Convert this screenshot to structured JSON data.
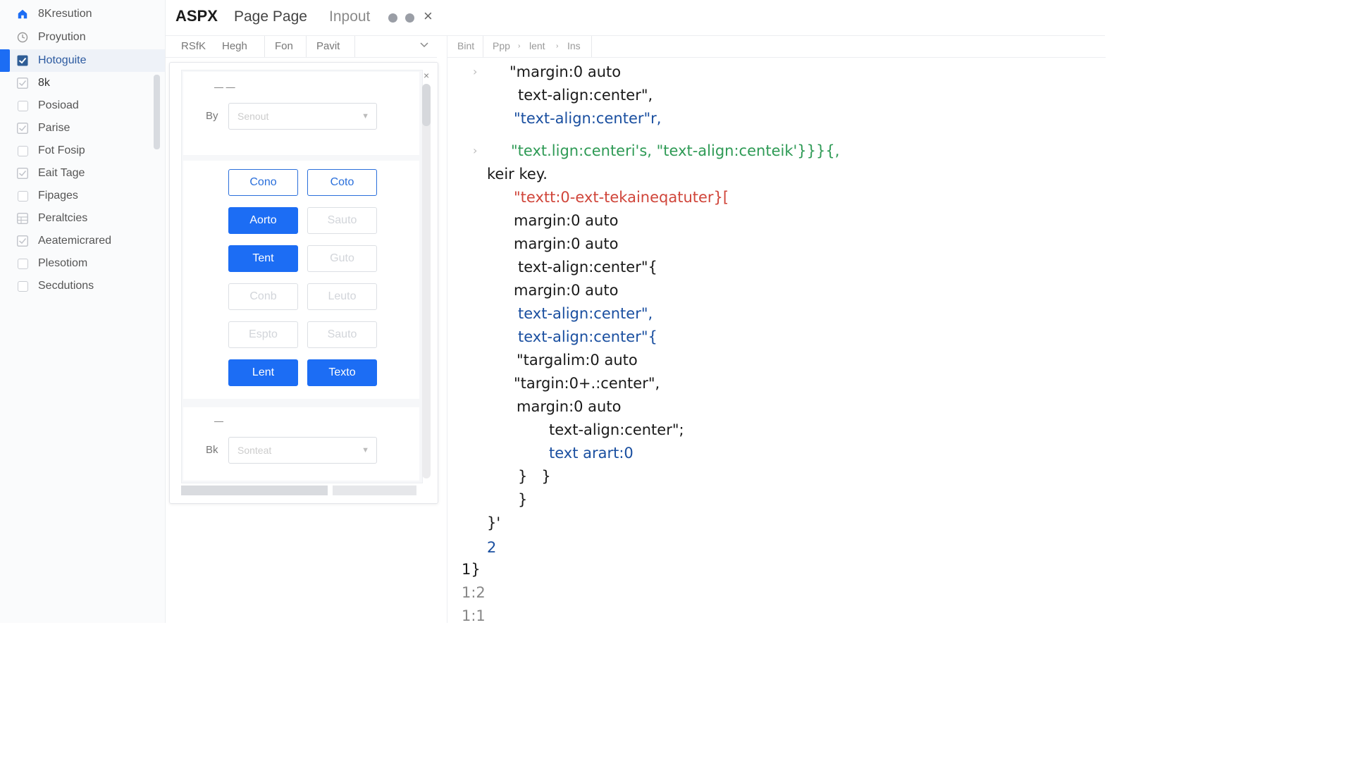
{
  "sidebar": {
    "items": [
      {
        "label": "8Kresution",
        "icon": "home-icon"
      },
      {
        "label": "Proyution",
        "icon": "clock-icon"
      },
      {
        "label": "Hotoguite",
        "icon": "checkbox-checked-icon",
        "active": true
      },
      {
        "label": "8k",
        "icon": "checkbox-checked-icon"
      },
      {
        "label": "Posioad",
        "icon": "checkbox-icon"
      },
      {
        "label": "Parise",
        "icon": "checkbox-checked-icon"
      },
      {
        "label": "Fot Fosip",
        "icon": "checkbox-icon"
      },
      {
        "label": "Eait Tage",
        "icon": "checkbox-checked-icon"
      },
      {
        "label": "Fipages",
        "icon": "checkbox-icon"
      },
      {
        "label": "Peraltcies",
        "icon": "grid-icon"
      },
      {
        "label": "Aeatemicrared",
        "icon": "checkbox-checked-icon"
      },
      {
        "label": "Plesotiom",
        "icon": "checkbox-icon"
      },
      {
        "label": "Secdutions",
        "icon": "checkbox-icon"
      }
    ]
  },
  "titlebar": {
    "app_title": "ASPX",
    "tab_page": "Page Page",
    "tab_input": "Inpout",
    "close_label": "×"
  },
  "left_toolbar": {
    "items": [
      "RSfK",
      "Hegh",
      "Fon",
      "Pavit"
    ]
  },
  "panel": {
    "close_label": "×",
    "section1_heading": "— —",
    "row1_label": "By",
    "row1_placeholder": "Senout",
    "section2_heading": "—",
    "row2_label": "Bk",
    "row2_placeholder": "Sonteat",
    "buttons": [
      {
        "label": "Cono"
      },
      {
        "label": "Coto"
      },
      {
        "label": "Aorto"
      },
      {
        "label": "Sauto"
      },
      {
        "label": "Tent"
      },
      {
        "label": "Guto"
      },
      {
        "label": "Conb"
      },
      {
        "label": "Leuto"
      },
      {
        "label": "Espto"
      },
      {
        "label": "Sauto"
      },
      {
        "label": "Lent"
      },
      {
        "label": "Texto"
      }
    ]
  },
  "breadcrumb": {
    "items": [
      "Bint",
      "Ppp",
      "lent",
      "Ins"
    ]
  },
  "code": {
    "lines": [
      "\"margin:0 auto",
      "text-align:center\",",
      "\"text-align:center\"r,",
      "\"text.lign:centeri's, \"text-align:centeik'}}}{,",
      "keir key.",
      "\"textt:0-ext-tekaineqatuter}[",
      "margin:0 auto",
      "margin:0 auto",
      "text-align:center\"{",
      "margin:0 auto",
      "text-align:center\",",
      "text-align:center\"{",
      "\"targalim:0 auto",
      "\"targin:0+.:center\",",
      "margin:0 auto",
      "text-align:center\";",
      "text arart:0",
      "}   }",
      "}",
      "}'",
      "2",
      "1}",
      "1:2",
      "1:1"
    ]
  }
}
